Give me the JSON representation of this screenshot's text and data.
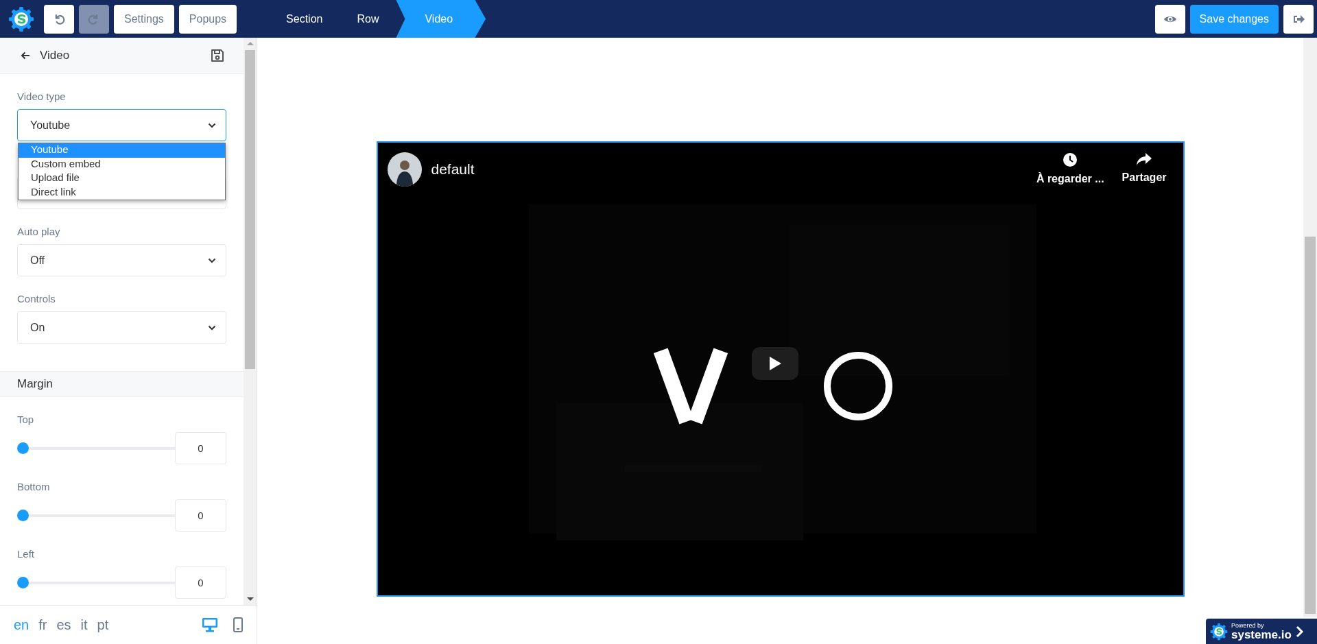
{
  "topbar": {
    "history": [
      {
        "kind": "undo",
        "disabled": false
      },
      {
        "kind": "redo",
        "disabled": true
      }
    ],
    "menu": [
      "Settings",
      "Popups"
    ],
    "breadcrumbs": [
      {
        "label": "Section",
        "selected": false
      },
      {
        "label": "Row",
        "selected": false
      },
      {
        "label": "Video",
        "selected": true
      }
    ],
    "save_label": "Save changes"
  },
  "sidebar": {
    "title": "Video",
    "fields": [
      {
        "kind": "select",
        "label": "Video type",
        "value": "Youtube",
        "expanded": true,
        "options": [
          {
            "label": "Youtube",
            "selected": true
          },
          {
            "label": "Custom embed",
            "selected": false
          },
          {
            "label": "Upload file",
            "selected": false
          },
          {
            "label": "Direct link",
            "selected": false
          }
        ]
      },
      {
        "kind": "covered"
      },
      {
        "kind": "select",
        "label": "Auto play",
        "value": "Off",
        "expanded": false
      },
      {
        "kind": "select",
        "label": "Controls",
        "value": "On",
        "expanded": false
      }
    ],
    "margin": {
      "title": "Margin",
      "sliders": [
        {
          "label": "Top",
          "level": 0,
          "value": "0"
        },
        {
          "label": "Bottom",
          "level": 0,
          "value": "0"
        },
        {
          "label": "Left",
          "level": 0,
          "value": "0"
        }
      ]
    },
    "languages": [
      {
        "label": "en",
        "selected": true
      },
      {
        "label": "fr",
        "selected": false
      },
      {
        "label": "es",
        "selected": false
      },
      {
        "label": "it",
        "selected": false
      },
      {
        "label": "pt",
        "selected": false
      }
    ],
    "devices": [
      {
        "kind": "desktop",
        "selected": true
      },
      {
        "kind": "mobile",
        "selected": false
      }
    ]
  },
  "video": {
    "channel": "default",
    "actions": [
      {
        "kind": "watch-later",
        "label": "À regarder ..."
      },
      {
        "kind": "share",
        "label": "Partager"
      }
    ]
  },
  "badge": {
    "top": "Powered by",
    "brand": "systeme.io"
  }
}
